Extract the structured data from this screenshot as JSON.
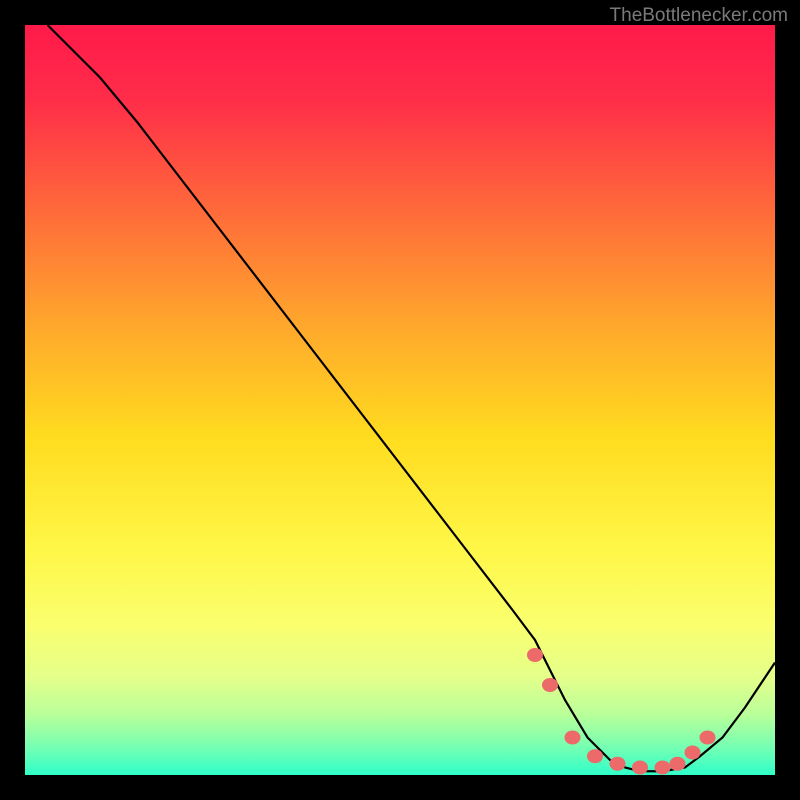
{
  "watermark": "TheBottlenecker.com",
  "chart_data": {
    "type": "line",
    "title": "",
    "xlabel": "",
    "ylabel": "",
    "xlim": [
      0,
      100
    ],
    "ylim": [
      0,
      100
    ],
    "grid": false,
    "series": [
      {
        "name": "bottleneck-curve",
        "x": [
          3,
          6,
          10,
          15,
          20,
          25,
          30,
          35,
          40,
          45,
          50,
          55,
          60,
          65,
          68,
          70,
          72,
          75,
          78,
          80,
          82,
          85,
          88,
          90,
          93,
          96,
          100
        ],
        "y": [
          100,
          97,
          93,
          87,
          80.5,
          74,
          67.5,
          61,
          54.5,
          48,
          41.5,
          35,
          28.5,
          22,
          18,
          14,
          10,
          5,
          2,
          1,
          0.5,
          0.5,
          1,
          2.5,
          5,
          9,
          15
        ]
      }
    ],
    "markers": {
      "name": "optimal-zone-dots",
      "x": [
        68,
        70,
        73,
        76,
        79,
        82,
        85,
        87,
        89,
        91
      ],
      "y": [
        16,
        12,
        5,
        2.5,
        1.5,
        1,
        1,
        1.5,
        3,
        5
      ]
    },
    "gradient_stops": [
      {
        "offset": 0.0,
        "color": "#ff1a4a"
      },
      {
        "offset": 0.1,
        "color": "#ff2d49"
      },
      {
        "offset": 0.25,
        "color": "#ff6b3a"
      },
      {
        "offset": 0.4,
        "color": "#ffa72c"
      },
      {
        "offset": 0.55,
        "color": "#ffdc1f"
      },
      {
        "offset": 0.7,
        "color": "#fff748"
      },
      {
        "offset": 0.8,
        "color": "#faff6e"
      },
      {
        "offset": 0.87,
        "color": "#e4ff8a"
      },
      {
        "offset": 0.92,
        "color": "#b8ff9a"
      },
      {
        "offset": 0.96,
        "color": "#7affb0"
      },
      {
        "offset": 1.0,
        "color": "#2fffc9"
      }
    ]
  }
}
